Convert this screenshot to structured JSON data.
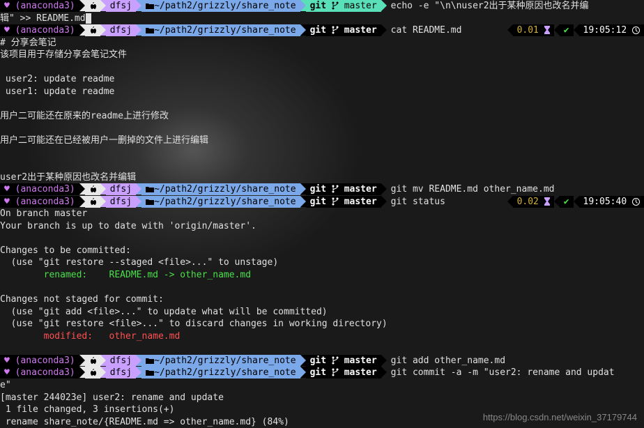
{
  "env": "(anaconda3)",
  "user": "dfsj",
  "path": "~/path2/grizzly/share_note",
  "vcs": "git",
  "branch": "master",
  "prompts": [
    {
      "cmd_part1": "echo -e \"\\n\\nuser2出于某种原因也改名并编",
      "cmd_part2": "辑\" >> README.md",
      "teal": true,
      "wrap": true
    },
    {
      "cmd": "cat README.md",
      "right": {
        "time_num": "0.01",
        "clock": "19:05:12"
      }
    },
    {
      "cmd": "git mv README.md other_name.md"
    },
    {
      "cmd": "git status",
      "right": {
        "time_num": "0.02",
        "clock": "19:05:40"
      }
    },
    {
      "cmd": "git add other_name.md"
    },
    {
      "cmd_part1": "git commit -a -m \"user2: rename and updat",
      "cmd_part2": "e\"",
      "wrap": true
    }
  ],
  "cat_output": {
    "title": "# 分享会笔记",
    "blank": "",
    "desc": "该项目用于存储分享会笔记文件",
    "l1": " user2: update readme",
    "l2": " user1: update readme",
    "l3": "用户二可能还在原来的readme上进行修改",
    "l4": "用户二可能还在已经被用户一删掉的文件上进行编辑",
    "l5": "user2出于某种原因也改名并编辑"
  },
  "status_output": {
    "l0": "On branch master",
    "l1": "Your branch is up to date with 'origin/master'.",
    "l2": "Changes to be committed:",
    "l3": "  (use \"git restore --staged <file>...\" to unstage)",
    "l4": "        renamed:    README.md -> other_name.md",
    "l5": "Changes not staged for commit:",
    "l6": "  (use \"git add <file>...\" to update what will be committed)",
    "l7": "  (use \"git restore <file>...\" to discard changes in working directory)",
    "l8": "        modified:   other_name.md"
  },
  "commit_output": {
    "l0": "[master 244023e] user2: rename and update",
    "l1": " 1 file changed, 3 insertions(+)",
    "l2": " rename share_note/{README.md => other_name.md} (84%)"
  },
  "watermark": "https://blog.csdn.net/weixin_37179744"
}
